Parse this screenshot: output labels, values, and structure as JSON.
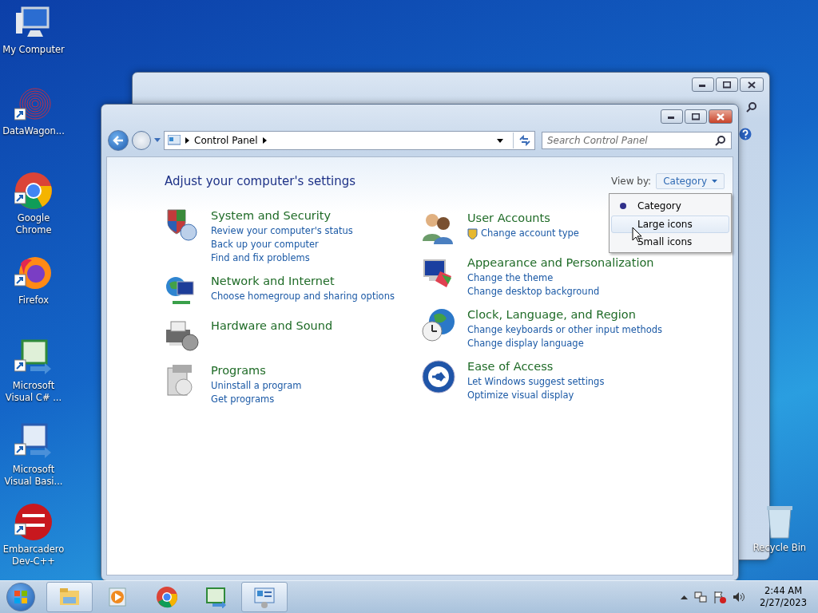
{
  "desktop_icons": [
    {
      "label": "My Computer",
      "shortcut": false
    },
    {
      "label": "DataWagon...",
      "shortcut": true
    },
    {
      "label": "Google Chrome",
      "shortcut": true
    },
    {
      "label": "Firefox",
      "shortcut": true
    },
    {
      "label": "Microsoft Visual C# ...",
      "shortcut": true
    },
    {
      "label": "Microsoft Visual Basi...",
      "shortcut": true
    },
    {
      "label": "Embarcadero Dev-C++",
      "shortcut": true
    }
  ],
  "recycle_bin": {
    "label": "Recycle Bin"
  },
  "window": {
    "address": {
      "crumb": "Control Panel"
    },
    "search": {
      "placeholder": "Search Control Panel"
    },
    "heading": "Adjust your computer's settings",
    "view_by": {
      "label": "View by:",
      "value": "Category"
    },
    "view_menu": [
      {
        "label": "Category",
        "selected": true,
        "hovered": false
      },
      {
        "label": "Large icons",
        "selected": false,
        "hovered": true
      },
      {
        "label": "Small icons",
        "selected": false,
        "hovered": false
      }
    ],
    "left_column": [
      {
        "title": "System and Security",
        "links": [
          {
            "text": "Review your computer's status",
            "shield": false
          },
          {
            "text": "Back up your computer",
            "shield": false
          },
          {
            "text": "Find and fix problems",
            "shield": false
          }
        ]
      },
      {
        "title": "Network and Internet",
        "links": [
          {
            "text": "Choose homegroup and sharing options",
            "shield": false
          }
        ]
      },
      {
        "title": "Hardware and Sound"
      },
      {
        "title": "Programs",
        "links": [
          {
            "text": "Uninstall a program",
            "shield": false
          },
          {
            "text": "Get programs",
            "shield": false
          }
        ]
      }
    ],
    "right_column": [
      {
        "title": "User Accounts",
        "links": [
          {
            "text": "Change account type",
            "shield": true
          }
        ]
      },
      {
        "title": "Appearance and Personalization",
        "links": [
          {
            "text": "Change the theme",
            "shield": false
          },
          {
            "text": "Change desktop background",
            "shield": false
          }
        ]
      },
      {
        "title": "Clock, Language, and Region",
        "links": [
          {
            "text": "Change keyboards or other input methods",
            "shield": false
          },
          {
            "text": "Change display language",
            "shield": false
          }
        ]
      },
      {
        "title": "Ease of Access",
        "links": [
          {
            "text": "Let Windows suggest settings",
            "shield": false
          },
          {
            "text": "Optimize visual display",
            "shield": false
          }
        ]
      }
    ]
  },
  "taskbar": {
    "apps": [
      {
        "active": true
      },
      {
        "active": false
      },
      {
        "active": false
      },
      {
        "active": false
      },
      {
        "active": true
      }
    ],
    "time": "2:44 AM",
    "date": "2/27/2023"
  }
}
